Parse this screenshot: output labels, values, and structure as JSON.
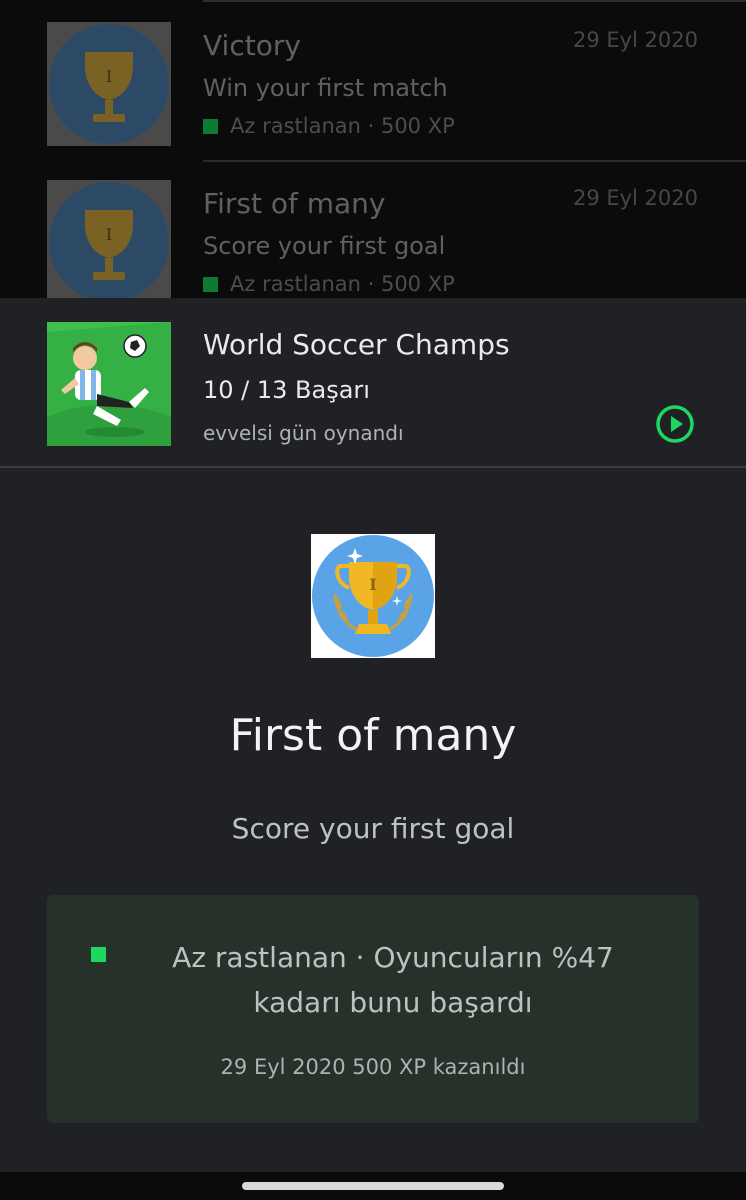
{
  "achievement_list": [
    {
      "title": "Victory",
      "description": "Win your first match",
      "meta": "Az rastlanan · 500 XP",
      "date": "29 Eyl 2020",
      "icon": "trophy-icon"
    },
    {
      "title": "First of many",
      "description": "Score your first goal",
      "meta": "Az rastlanan · 500 XP",
      "date": "29 Eyl 2020",
      "icon": "trophy-icon"
    }
  ],
  "game": {
    "name": "World Soccer Champs",
    "progress": "10 / 13 Başarı",
    "last_played": "evvelsi gün oynandı",
    "play_icon": "play-circle-icon"
  },
  "detail": {
    "title": "First of many",
    "description": "Score your first goal",
    "rarity": "Az rastlanan · Oyuncuların %47 kadarı bunu başardı",
    "earned": "29 Eyl 2020 500 XP kazanıldı",
    "icon": "trophy-icon"
  },
  "colors": {
    "accent_green": "#1ed760",
    "card_bg": "#253129",
    "sheet_bg": "#202124",
    "trophy_circle": "#5aa3e6",
    "trophy_gold": "#f2b824"
  }
}
